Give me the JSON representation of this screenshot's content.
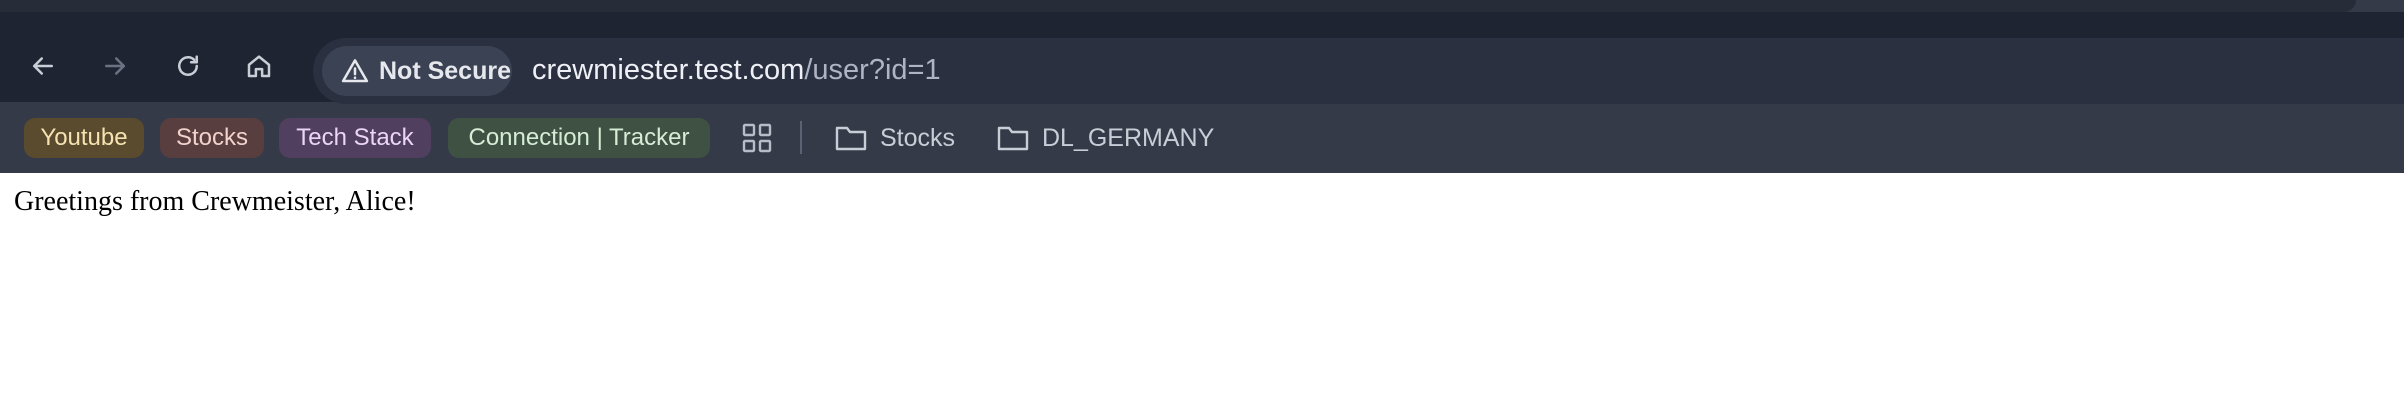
{
  "toolbar": {
    "back_icon": "arrow-left-icon",
    "forward_icon": "arrow-right-icon",
    "reload_icon": "reload-icon",
    "home_icon": "home-icon"
  },
  "omnibox": {
    "security_icon": "warning-triangle-icon",
    "security_label": "Not Secure",
    "url_host": "crewmiester.test.com",
    "url_path": "/user?id=1"
  },
  "bookmarks": {
    "chips": [
      {
        "label": "Youtube",
        "bg": "#5a4a2e",
        "fg": "#f5e2b0"
      },
      {
        "label": "Stocks",
        "bg": "#583e3e",
        "fg": "#f2d2cc"
      },
      {
        "label": "Tech Stack",
        "bg": "#503f5e",
        "fg": "#ecd5f5"
      },
      {
        "label": "Connection | Tracker",
        "bg": "#3f5143",
        "fg": "#d6ecd6"
      }
    ],
    "apps_icon": "grid-icon",
    "folders": [
      {
        "label": "Stocks",
        "icon": "folder-icon"
      },
      {
        "label": "DL_GERMANY",
        "icon": "folder-icon"
      }
    ]
  },
  "page": {
    "greeting": "Greetings from Crewmeister, Alice!"
  },
  "colors": {
    "toolbar_bg": "#1f2433",
    "bookmark_bar_bg": "#353a49",
    "omnibox_bg": "#2a3040",
    "page_bg": "#ffffff"
  }
}
